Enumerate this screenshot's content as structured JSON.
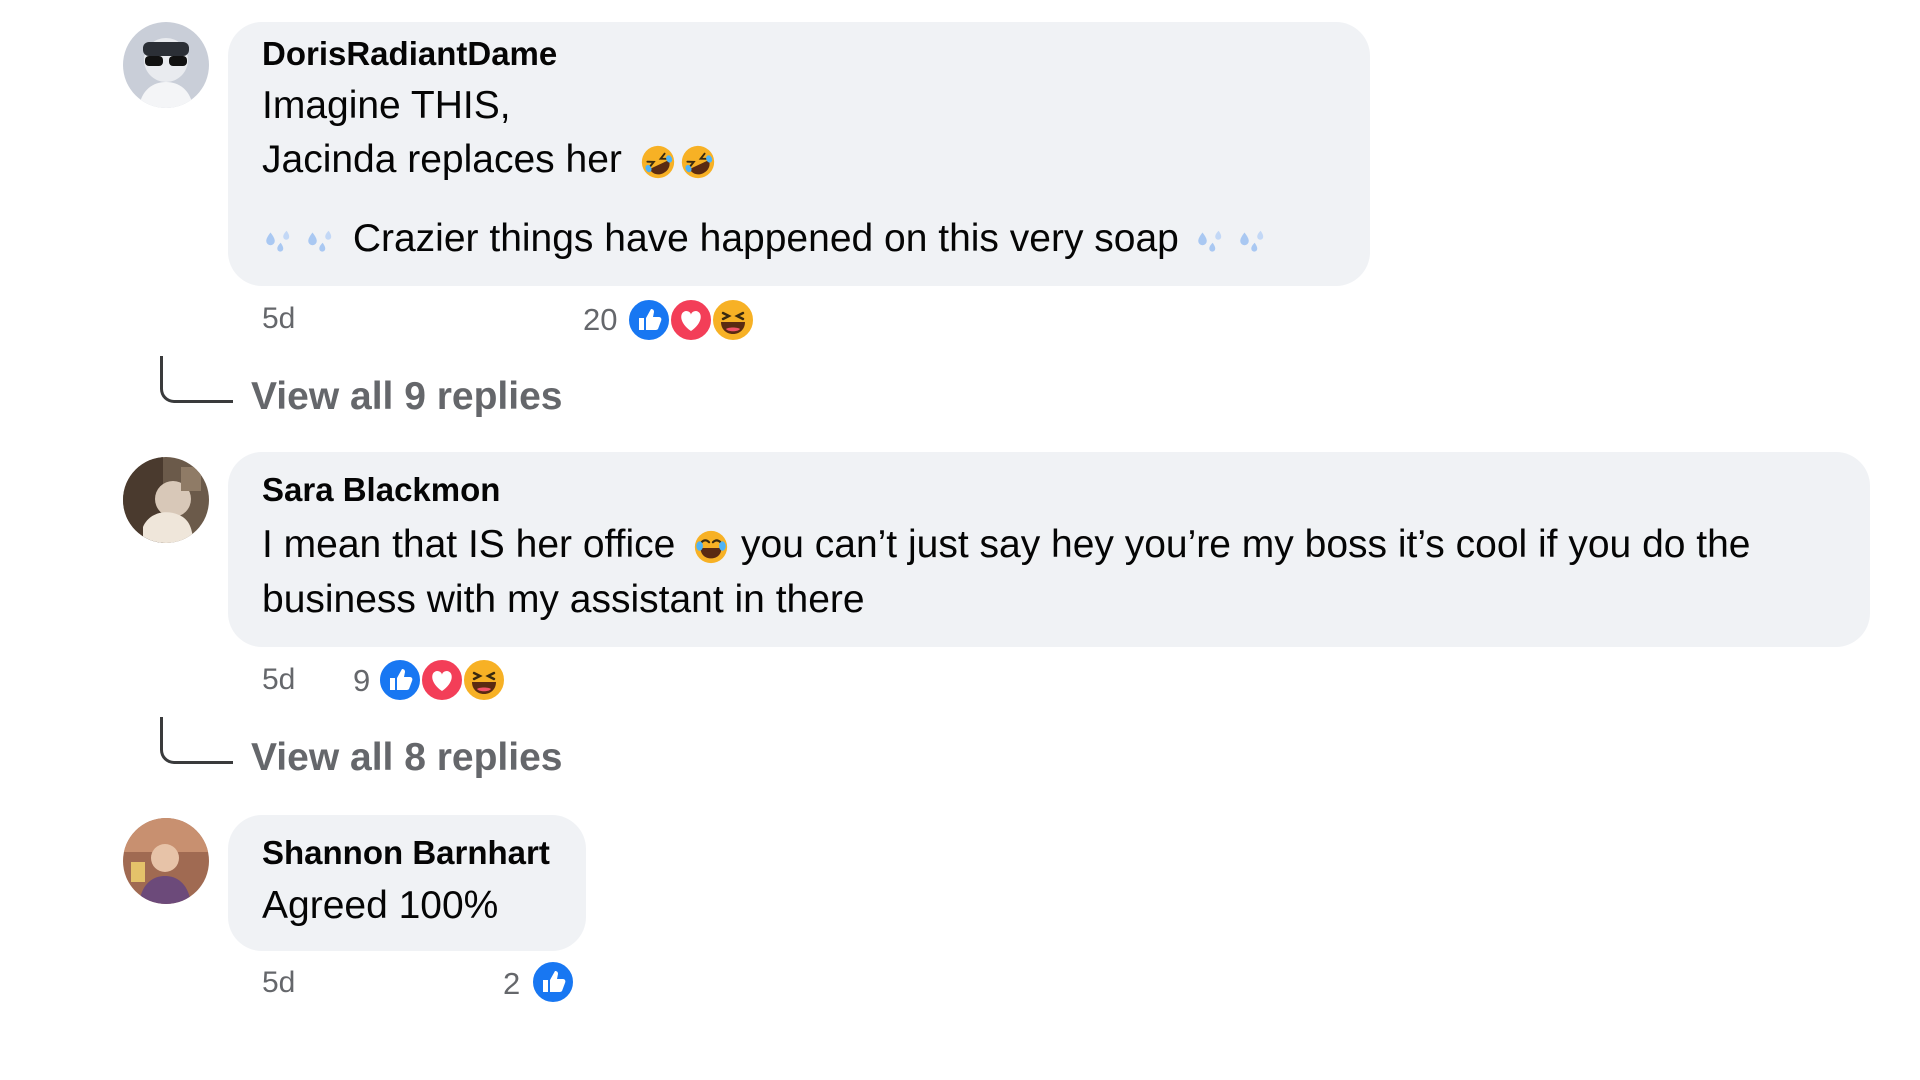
{
  "comments": [
    {
      "author": "DorisRadiantDame",
      "lines": [
        "Imagine THIS,",
        "Jacinda replaces her",
        "Crazier things have happened on this very soap"
      ],
      "time": "5d",
      "reactions": "20",
      "reaction_icons": [
        "like-icon",
        "love-icon",
        "haha-icon"
      ],
      "replies": "View all 9 replies"
    },
    {
      "author": "Sara Blackmon",
      "lines": [
        "I mean that IS her office",
        "you can’t just say hey you’re my boss it’s cool if you do the",
        "business with my assistant in there"
      ],
      "time": "5d",
      "reactions": "9",
      "reaction_icons": [
        "like-icon",
        "love-icon",
        "haha-icon"
      ],
      "replies": "View all 8 replies"
    },
    {
      "author": "Shannon Barnhart",
      "lines": [
        "Agreed 100%"
      ],
      "time": "5d",
      "reactions": "2",
      "reaction_icons": [
        "like-icon"
      ]
    }
  ],
  "colors": {
    "bubble": "#f0f2f5",
    "like": "#1877f2",
    "love": "#f33e58",
    "haha": "#f7b125",
    "meta": "#65676b"
  }
}
